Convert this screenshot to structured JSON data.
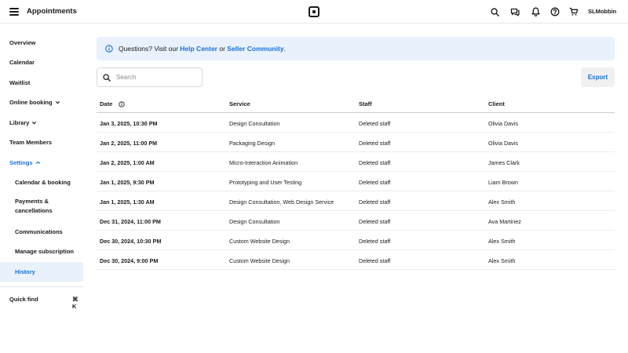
{
  "header": {
    "title": "Appointments",
    "username": "SLMobbin",
    "icons": [
      "search-icon",
      "messages-icon",
      "bell-icon",
      "help-icon",
      "cart-icon"
    ]
  },
  "sidebar": {
    "items": [
      {
        "label": "Overview"
      },
      {
        "label": "Calendar"
      },
      {
        "label": "Waitlist"
      },
      {
        "label": "Online booking"
      },
      {
        "label": "Library"
      },
      {
        "label": "Team Members"
      },
      {
        "label": "Settings"
      },
      {
        "label": "Calendar & booking"
      },
      {
        "label": "Payments &"
      },
      {
        "label": "Communications"
      },
      {
        "label": "Manage subscription"
      },
      {
        "label": "History"
      }
    ],
    "payments_line2": "cancellations",
    "quick_find": "Quick find",
    "quick_find_shortcut": "⌘ K"
  },
  "banner": {
    "prefix": "Questions? Visit our ",
    "link1": "Help Center",
    "middle": " or ",
    "link2": "Seller Community",
    "suffix": "."
  },
  "search": {
    "placeholder": "Search",
    "value": ""
  },
  "export_label": "Export",
  "table": {
    "headers": [
      "Date",
      "Service",
      "Staff",
      "Client"
    ],
    "rows": [
      [
        "Jan 3, 2025, 10:30 PM",
        "Design Consultation",
        "Deleted staff",
        "Olivia Davis"
      ],
      [
        "Jan 2, 2025, 11:00 PM",
        "Packaging Design",
        "Deleted staff",
        "Olivia Davis"
      ],
      [
        "Jan 2, 2025, 1:00 AM",
        "Micro-Interaction Animation",
        "Deleted staff",
        "James Clark"
      ],
      [
        "Jan 1, 2025, 9:30 PM",
        "Prototyping and User Testing",
        "Deleted staff",
        "Liam Brown"
      ],
      [
        "Jan 1, 2025, 1:30 AM",
        "Design Consultation, Web Design Service",
        "Deleted staff",
        "Alex Smith"
      ],
      [
        "Dec 31, 2024, 11:00 PM",
        "Design Consultation",
        "Deleted staff",
        "Ava Martinez"
      ],
      [
        "Dec 30, 2024, 10:30 PM",
        "Custom Website Design",
        "Deleted staff",
        "Alex Smith"
      ],
      [
        "Dec 30, 2024, 9:00 PM",
        "Custom Website Design",
        "Deleted staff",
        "Alex Smith"
      ]
    ]
  },
  "colors": {
    "accent": "#1a6fd6",
    "banner_bg": "#e8f1fc",
    "active_bg": "#e8f1fc"
  }
}
